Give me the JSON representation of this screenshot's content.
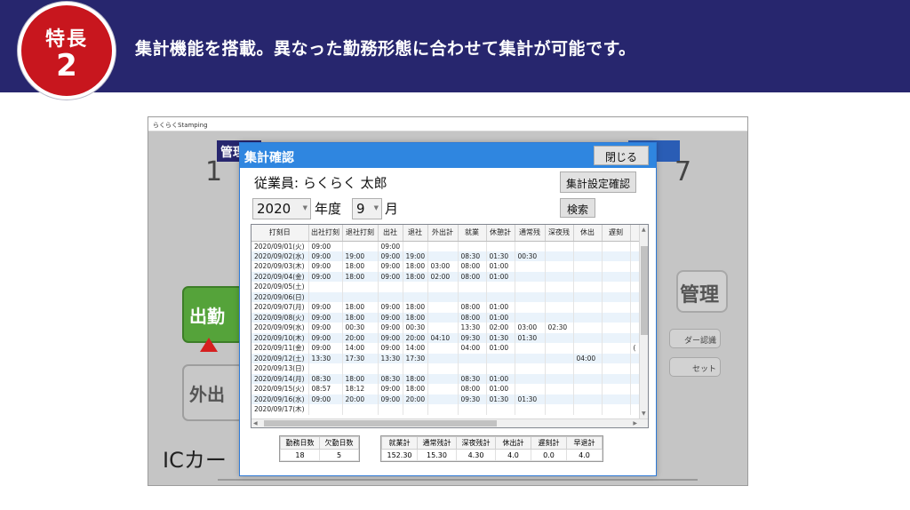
{
  "banner": {
    "badge_label": "特長",
    "badge_number": "2",
    "headline": "集計機能を搭載。異なった勤務形態に合わせて集計が可能です。"
  },
  "app": {
    "title": "らくらくStamping",
    "bg_header_text": "管理",
    "bg_digit_left": "1",
    "bg_digit_right": "7",
    "bg_clock_in": "出勤",
    "bg_out": "外出",
    "bg_ic_text": "ICカー",
    "bg_admin": "管理",
    "bg_card_auth": "ダー認識",
    "bg_reset": "セット"
  },
  "dialog": {
    "title": "集計確認",
    "close_label": "閉じる",
    "employee_label": "従業員: らくらく 太郎",
    "settings_label": "集計設定確認",
    "search_label": "検索",
    "year_value": "2020",
    "year_suffix": "年度",
    "month_value": "9",
    "month_suffix": "月"
  },
  "grid": {
    "columns": [
      "打刻日",
      "出社打刻",
      "退社打刻",
      "出社",
      "退社",
      "外出計",
      "就業",
      "休憩計",
      "通常残",
      "深夜残",
      "休出",
      "遅刻",
      ""
    ],
    "rows": [
      [
        "2020/09/01(火)",
        "09:00",
        "",
        "09:00",
        "",
        "",
        "",
        "",
        "",
        "",
        "",
        "",
        ""
      ],
      [
        "2020/09/02(水)",
        "09:00",
        "19:00",
        "09:00",
        "19:00",
        "",
        "08:30",
        "01:30",
        "00:30",
        "",
        "",
        "",
        ""
      ],
      [
        "2020/09/03(木)",
        "09:00",
        "18:00",
        "09:00",
        "18:00",
        "03:00",
        "08:00",
        "01:00",
        "",
        "",
        "",
        "",
        ""
      ],
      [
        "2020/09/04(金)",
        "09:00",
        "18:00",
        "09:00",
        "18:00",
        "02:00",
        "08:00",
        "01:00",
        "",
        "",
        "",
        "",
        ""
      ],
      [
        "2020/09/05(土)",
        "",
        "",
        "",
        "",
        "",
        "",
        "",
        "",
        "",
        "",
        "",
        ""
      ],
      [
        "2020/09/06(日)",
        "",
        "",
        "",
        "",
        "",
        "",
        "",
        "",
        "",
        "",
        "",
        ""
      ],
      [
        "2020/09/07(月)",
        "09:00",
        "18:00",
        "09:00",
        "18:00",
        "",
        "08:00",
        "01:00",
        "",
        "",
        "",
        "",
        ""
      ],
      [
        "2020/09/08(火)",
        "09:00",
        "18:00",
        "09:00",
        "18:00",
        "",
        "08:00",
        "01:00",
        "",
        "",
        "",
        "",
        ""
      ],
      [
        "2020/09/09(水)",
        "09:00",
        "00:30",
        "09:00",
        "00:30",
        "",
        "13:30",
        "02:00",
        "03:00",
        "02:30",
        "",
        "",
        ""
      ],
      [
        "2020/09/10(木)",
        "09:00",
        "20:00",
        "09:00",
        "20:00",
        "04:10",
        "09:30",
        "01:30",
        "01:30",
        "",
        "",
        "",
        ""
      ],
      [
        "2020/09/11(金)",
        "09:00",
        "14:00",
        "09:00",
        "14:00",
        "",
        "04:00",
        "01:00",
        "",
        "",
        "",
        "",
        "("
      ],
      [
        "2020/09/12(土)",
        "13:30",
        "17:30",
        "13:30",
        "17:30",
        "",
        "",
        "",
        "",
        "",
        "04:00",
        "",
        ""
      ],
      [
        "2020/09/13(日)",
        "",
        "",
        "",
        "",
        "",
        "",
        "",
        "",
        "",
        "",
        "",
        ""
      ],
      [
        "2020/09/14(月)",
        "08:30",
        "18:00",
        "08:30",
        "18:00",
        "",
        "08:30",
        "01:00",
        "",
        "",
        "",
        "",
        ""
      ],
      [
        "2020/09/15(火)",
        "08:57",
        "18:12",
        "09:00",
        "18:00",
        "",
        "08:00",
        "01:00",
        "",
        "",
        "",
        "",
        ""
      ],
      [
        "2020/09/16(水)",
        "09:00",
        "20:00",
        "09:00",
        "20:00",
        "",
        "09:30",
        "01:30",
        "01:30",
        "",
        "",
        "",
        ""
      ],
      [
        "2020/09/17(木)",
        "",
        "",
        "",
        "",
        "",
        "",
        "",
        "",
        "",
        "",
        "",
        ""
      ]
    ]
  },
  "summary1": {
    "headers": [
      "勤務日数",
      "欠勤日数"
    ],
    "values": [
      "18",
      "5"
    ]
  },
  "summary2": {
    "headers": [
      "就業計",
      "通常残計",
      "深夜残計",
      "休出計",
      "遅刻計",
      "早退計"
    ],
    "values": [
      "152.30",
      "15.30",
      "4.30",
      "4.0",
      "0.0",
      "4.0"
    ]
  }
}
